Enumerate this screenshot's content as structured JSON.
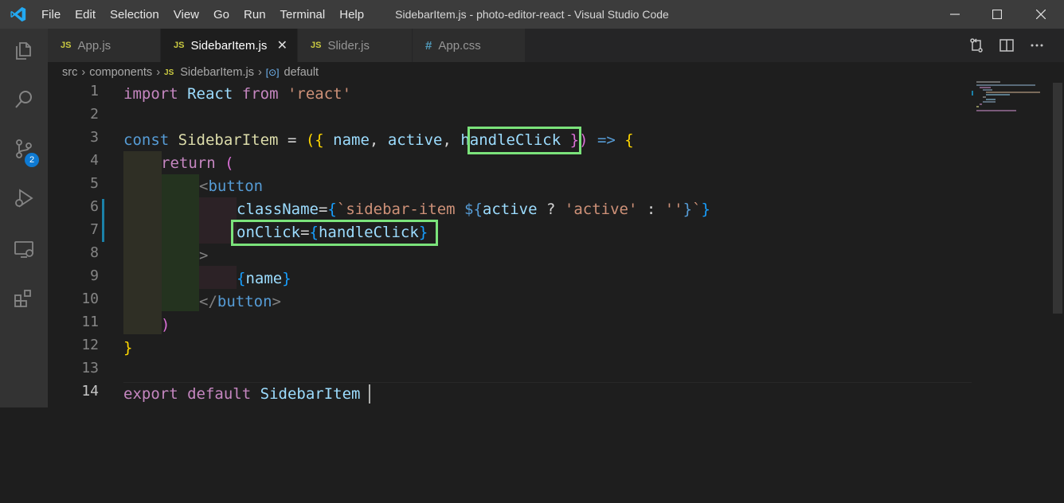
{
  "titlebar": {
    "menu": [
      "File",
      "Edit",
      "Selection",
      "View",
      "Go",
      "Run",
      "Terminal",
      "Help"
    ],
    "window_title": "SidebarItem.js - photo-editor-react - Visual Studio Code"
  },
  "activity_bar": {
    "items": [
      "explorer-icon",
      "search-icon",
      "source-control-icon",
      "run-debug-icon",
      "remote-explorer-icon",
      "extensions-icon"
    ],
    "scm_badge": "2"
  },
  "tabs": [
    {
      "icon": "JS",
      "label": "App.js",
      "active": false
    },
    {
      "icon": "JS",
      "label": "SidebarItem.js",
      "active": true
    },
    {
      "icon": "JS",
      "label": "Slider.js",
      "active": false
    },
    {
      "icon": "#",
      "label": "App.css",
      "active": false
    }
  ],
  "breadcrumb": {
    "parts": [
      "src",
      "components"
    ],
    "file_icon": "JS",
    "file": "SidebarItem.js",
    "symbol": "default"
  },
  "editor": {
    "line_numbers": [
      "1",
      "2",
      "3",
      "4",
      "5",
      "6",
      "7",
      "8",
      "9",
      "10",
      "11",
      "12",
      "13",
      "14"
    ],
    "current_line": "14",
    "l1": {
      "kw": "import",
      "name": "React",
      "from": "from",
      "mod": "'react'"
    },
    "l3": {
      "kw": "const",
      "name": "SidebarItem",
      "eq": " = ",
      "open": "({ ",
      "p1": "name",
      "c1": ", ",
      "p2": "active",
      "c2": ", ",
      "p3": "handleClick",
      "close": " })",
      "arrow": " => ",
      "brace": "{"
    },
    "l4": {
      "kw": "return",
      "paren": " ("
    },
    "l5": {
      "lt": "<",
      "tag": "button"
    },
    "l6": {
      "attr": "className",
      "eq": "=",
      "ob": "{",
      "tick": "`",
      "text": "sidebar-item ",
      "dol": "${",
      "id": "active",
      "q": " ? ",
      "s1": "'active'",
      "colon": " : ",
      "s2": "''",
      "cb": "}",
      "tick2": "`",
      "end": "}"
    },
    "l7": {
      "attr": "onClick",
      "eq": "=",
      "ob": "{",
      "id": "handleClick",
      "cb": "}"
    },
    "l8": {
      "gt": ">"
    },
    "l9": {
      "ob": "{",
      "id": "name",
      "cb": "}"
    },
    "l10": {
      "lt": "</",
      "tag": "button",
      "gt": ">"
    },
    "l11": {
      "paren": ")"
    },
    "l12": {
      "brace": "}"
    },
    "l14": {
      "kw": "export",
      "kw2": "default",
      "name": "SidebarItem"
    }
  }
}
